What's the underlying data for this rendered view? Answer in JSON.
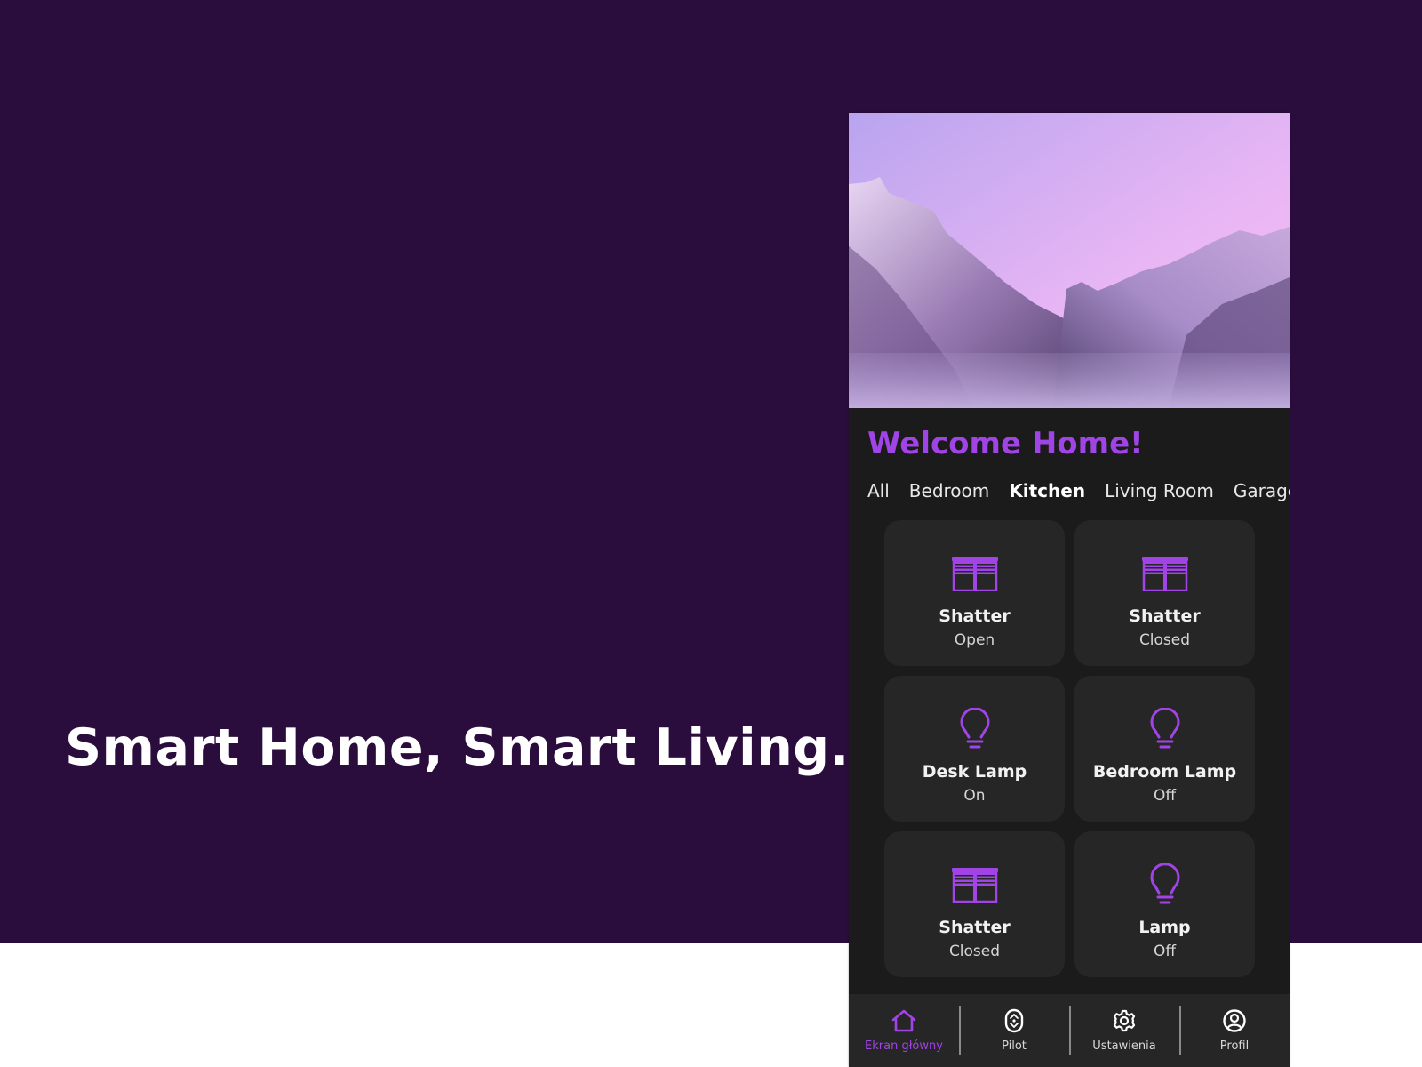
{
  "tagline": "Smart Home, Smart Living.",
  "colors": {
    "background_purple": "#2a0d3d",
    "accent": "#a044e6",
    "phone_bg": "#1b1b1b",
    "card_bg": "#262626"
  },
  "app": {
    "header_image": "mountain-landscape-photo",
    "welcome_title": "Welcome Home!",
    "room_tabs": [
      {
        "label": "All",
        "active": false
      },
      {
        "label": "Bedroom",
        "active": false
      },
      {
        "label": "Kitchen",
        "active": true
      },
      {
        "label": "Living Room",
        "active": false
      },
      {
        "label": "Garage",
        "active": false
      }
    ],
    "devices": [
      {
        "name": "Shatter",
        "state": "Open",
        "icon": "window-blinds-icon"
      },
      {
        "name": "Shatter",
        "state": "Closed",
        "icon": "window-blinds-icon"
      },
      {
        "name": "Desk Lamp",
        "state": "On",
        "icon": "lightbulb-icon"
      },
      {
        "name": "Bedroom Lamp",
        "state": "Off",
        "icon": "lightbulb-icon"
      },
      {
        "name": "Shatter",
        "state": "Closed",
        "icon": "window-blinds-icon"
      },
      {
        "name": "Lamp",
        "state": "Off",
        "icon": "lightbulb-icon"
      }
    ],
    "bottom_nav": [
      {
        "label": "Ekran główny",
        "icon": "home-icon",
        "active": true
      },
      {
        "label": "Pilot",
        "icon": "remote-icon",
        "active": false
      },
      {
        "label": "Ustawienia",
        "icon": "gear-icon",
        "active": false
      },
      {
        "label": "Profil",
        "icon": "profile-icon",
        "active": false
      }
    ]
  }
}
